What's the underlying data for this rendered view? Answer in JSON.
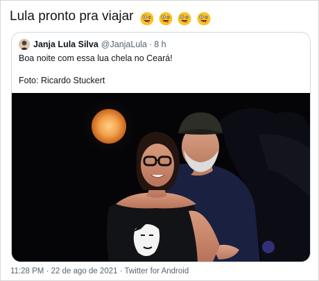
{
  "tweet": {
    "text": "Lula pronto pra viajar",
    "emojis": [
      "zany-face-emoji",
      "zany-face-emoji",
      "zany-face-emoji",
      "zany-face-emoji"
    ],
    "timestamp": "11:28 PM · 22 de ago de 2021",
    "separator": " · ",
    "source": "Twitter for Android"
  },
  "quoted_tweet": {
    "author_name": "Janja Lula Silva",
    "handle": "@JanjaLula",
    "dot": "·",
    "time": "8 h",
    "text": "Boa noite com essa lua chela no Ceará!",
    "photo_credit": "Foto: Ricardo Stuckert",
    "photo": "night-photo-couple-under-full-moon"
  },
  "colors": {
    "text": "#0f1419",
    "muted": "#536471",
    "border": "#cfd9de",
    "moon": "#f4a04a",
    "photo_bg": "#050508"
  }
}
